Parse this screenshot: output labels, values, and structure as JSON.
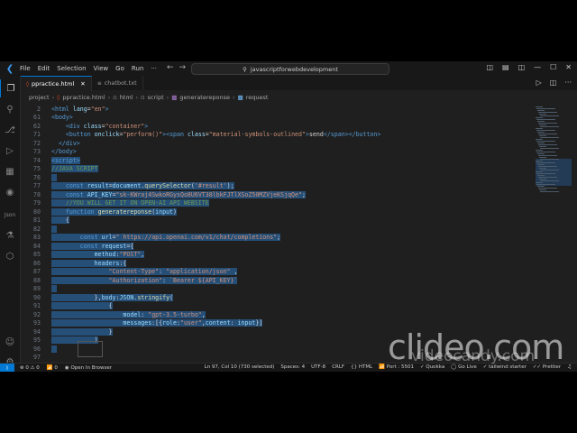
{
  "titlebar": {
    "menu": [
      "File",
      "Edit",
      "Selection",
      "View",
      "Go",
      "Run",
      "···"
    ],
    "search_text": "javascriptforwebdevelopment"
  },
  "tabs": [
    {
      "label": "ppractice.html",
      "icon": "html-file-icon",
      "active": true
    },
    {
      "label": "chatbot.txt",
      "icon": "text-file-icon",
      "active": false
    }
  ],
  "breadcrumb": [
    "project",
    "ppractice.html",
    "html",
    "script",
    "generatereponse",
    "request"
  ],
  "code_lines": [
    {
      "n": "2",
      "html": "<span class='c-tag'>&lt;html</span> <span class='c-attr'>lang</span>=<span class='c-str'>\"en\"</span><span class='c-tag'>&gt;</span>",
      "sel": false
    },
    {
      "n": "61",
      "html": "<span class='c-tag'>&lt;body&gt;</span>",
      "sel": false
    },
    {
      "n": "62",
      "html": "    <span class='c-tag'>&lt;div</span> <span class='c-attr'>class</span>=<span class='c-str'>\"container\"</span><span class='c-tag'>&gt;</span>",
      "sel": false
    },
    {
      "n": "71",
      "html": "    <span class='c-tag'>&lt;button</span> <span class='c-attr'>onclick</span>=<span class='c-str'>\"perform()\"</span><span class='c-tag'>&gt;&lt;span</span> <span class='c-attr'>class</span>=<span class='c-str'>\"material-symbols-outlined\"</span><span class='c-tag'>&gt;</span>send<span class='c-tag'>&lt;/span&gt;&lt;/button&gt;</span>",
      "sel": false
    },
    {
      "n": "72",
      "html": "  <span class='c-tag'>&lt;/div&gt;</span>",
      "sel": false
    },
    {
      "n": "73",
      "html": "<span class='c-tag'>&lt;/body&gt;</span>",
      "sel": false
    },
    {
      "n": "74",
      "html": "<span class='c-tag'>&lt;script&gt;</span>",
      "sel": true
    },
    {
      "n": "75",
      "html": "<span class='c-cm'>//JAVA SCRIPT</span>",
      "sel": true
    },
    {
      "n": "76",
      "html": "",
      "sel": true
    },
    {
      "n": "77",
      "html": "    <span class='c-kw'>const</span> <span class='c-var'>result</span>=<span class='c-var'>document</span>.<span class='c-fn'>querySelector</span>(<span class='c-str'>'#result'</span>);",
      "sel": true
    },
    {
      "n": "78",
      "html": "    <span class='c-kw'>const</span> <span class='c-var'>API_KEY</span>=<span class='c-str'>\"sk-KWraj4SwkoRGysQo8U6VT38lbkFJTlXSoZ50MZVjeKSjqQe\"</span>;",
      "sel": true
    },
    {
      "n": "79",
      "html": "    <span class='c-cm'>//YOU WILL GET IT ON OPEN-AI API WEBSITE</span>",
      "sel": true
    },
    {
      "n": "80",
      "html": "    <span class='c-kw'>function</span> <span class='c-fn'>generatereponse</span>(<span class='c-var'>input</span>)",
      "sel": true
    },
    {
      "n": "81",
      "html": "    {",
      "sel": true
    },
    {
      "n": "82",
      "html": "",
      "sel": true
    },
    {
      "n": "83",
      "html": "        <span class='c-kw'>const</span> <span class='c-var'>url</span>=<span class='c-str'>\" https://api.openai.com/v1/chat/completions\"</span>;",
      "sel": true
    },
    {
      "n": "84",
      "html": "        <span class='c-kw'>const</span> <span class='c-var'>request</span>={",
      "sel": true
    },
    {
      "n": "85",
      "html": "            <span class='c-var'>method</span>:<span class='c-str'>\"POST\"</span>,",
      "sel": true
    },
    {
      "n": "86",
      "html": "            <span class='c-var'>headers</span>:{",
      "sel": true
    },
    {
      "n": "87",
      "html": "                <span class='c-str'>\"Content-Type\"</span>: <span class='c-str'>\"application/json\"</span> ,",
      "sel": true
    },
    {
      "n": "88",
      "html": "                <span class='c-str'>\"Authorization\"</span>: <span class='c-str'>`Bearer ${API_KEY}`</span>",
      "sel": true
    },
    {
      "n": "89",
      "html": "",
      "sel": true
    },
    {
      "n": "90",
      "html": "            },<span class='c-var'>body</span>:<span class='c-var'>JSON</span>.<span class='c-fn'>stringify</span>(",
      "sel": true
    },
    {
      "n": "91",
      "html": "                {",
      "sel": true
    },
    {
      "n": "92",
      "html": "                    <span class='c-var'>model</span>: <span class='c-str'>\"gpt-3.5-turbo\"</span>,",
      "sel": true
    },
    {
      "n": "93",
      "html": "                    <span class='c-var'>messages</span>:[{<span class='c-var'>role</span>:<span class='c-str'>\"user\"</span>,<span class='c-var'>content</span>: <span class='c-var'>input</span>}]",
      "sel": true
    },
    {
      "n": "94",
      "html": "                }",
      "sel": true
    },
    {
      "n": "95",
      "html": "            )",
      "sel": true
    },
    {
      "n": "96",
      "html": "",
      "sel": true
    },
    {
      "n": "97",
      "html": "",
      "sel": false
    }
  ],
  "statusbar": {
    "errors": "0",
    "warnings": "0",
    "ports": "0",
    "open_in_browser": "Open In Browser",
    "position": "Ln 97, Col 10 (730 selected)",
    "spaces": "Spaces: 4",
    "encoding": "UTF-8",
    "eol": "CRLF",
    "language": "HTML",
    "port": "Port : 5501",
    "quokka": "Quokka",
    "go_live": "Go Live",
    "tailwind": "tailwind starter",
    "prettier": "Prettier"
  },
  "watermark": {
    "main": "clideo.com",
    "sub": "videocandy.com"
  }
}
